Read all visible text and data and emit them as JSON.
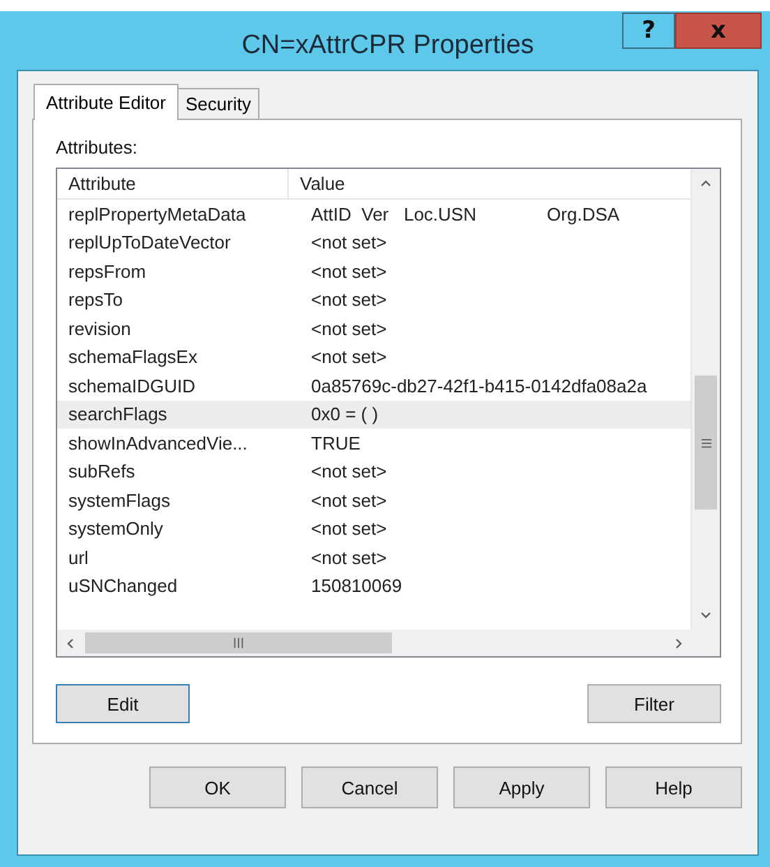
{
  "window": {
    "title": "CN=xAttrCPR Properties",
    "help_button": "?",
    "close_button": "x"
  },
  "tabs": [
    {
      "label": "Attribute Editor",
      "selected": true
    },
    {
      "label": "Security",
      "selected": false
    }
  ],
  "attributes_label": "Attributes:",
  "table": {
    "columns": [
      "Attribute",
      "Value"
    ],
    "rows": [
      {
        "attribute": "replPropertyMetaData",
        "value": "AttID  Ver   Loc.USN              Org.DSA",
        "selected": false
      },
      {
        "attribute": "replUpToDateVector",
        "value": "<not set>",
        "selected": false
      },
      {
        "attribute": "repsFrom",
        "value": "<not set>",
        "selected": false
      },
      {
        "attribute": "repsTo",
        "value": "<not set>",
        "selected": false
      },
      {
        "attribute": "revision",
        "value": "<not set>",
        "selected": false
      },
      {
        "attribute": "schemaFlagsEx",
        "value": "<not set>",
        "selected": false
      },
      {
        "attribute": "schemaIDGUID",
        "value": "0a85769c-db27-42f1-b415-0142dfa08a2a",
        "selected": false
      },
      {
        "attribute": "searchFlags",
        "value": "0x0 = ( )",
        "selected": true
      },
      {
        "attribute": "showInAdvancedVie...",
        "value": "TRUE",
        "selected": false
      },
      {
        "attribute": "subRefs",
        "value": "<not set>",
        "selected": false
      },
      {
        "attribute": "systemFlags",
        "value": "<not set>",
        "selected": false
      },
      {
        "attribute": "systemOnly",
        "value": "<not set>",
        "selected": false
      },
      {
        "attribute": "url",
        "value": "<not set>",
        "selected": false
      },
      {
        "attribute": "uSNChanged",
        "value": "150810069",
        "selected": false
      }
    ]
  },
  "panel_buttons": [
    {
      "label": "Edit",
      "focused": true
    },
    {
      "label": "Filter",
      "focused": false
    }
  ],
  "dialog_buttons": [
    "OK",
    "Cancel",
    "Apply",
    "Help"
  ]
}
